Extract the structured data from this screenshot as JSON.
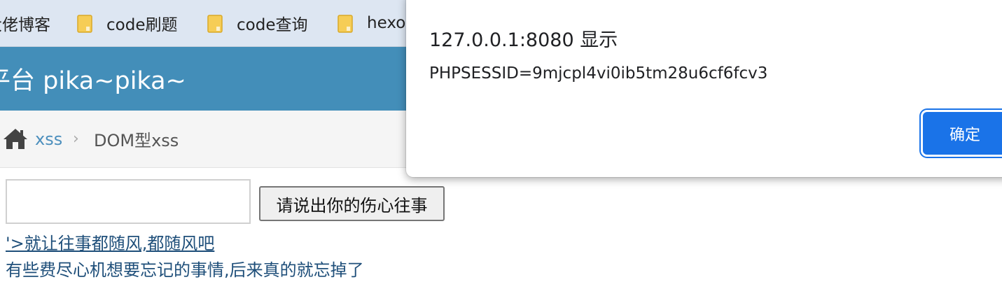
{
  "bookmarks": {
    "items": [
      {
        "label": "大佬博客",
        "icon": "folder-icon"
      },
      {
        "label": "code刷题",
        "icon": "folder-icon"
      },
      {
        "label": "code查询",
        "icon": "folder-icon"
      },
      {
        "label": "hexo",
        "icon": "folder-icon"
      }
    ],
    "folder_color": "#f6cd56"
  },
  "header": {
    "title": "漏洞练习平台 pika~pika~",
    "background": "#438eb9"
  },
  "breadcrumb": {
    "home_icon": "home-icon",
    "link": "xss",
    "separator": "›",
    "current": "DOM型xss"
  },
  "form": {
    "input_value": "",
    "button_label": "请说出你的伤心往事"
  },
  "result": {
    "link_text": "'>就让往事都随风,都随风吧",
    "hint_text": "有些费尽心机想要忘记的事情,后来真的就忘掉了"
  },
  "dialog": {
    "title": "127.0.0.1:8080 显示",
    "message": "PHPSESSID=9mjcpl4vi0ib5tm28u6cf6fcv3",
    "ok_label": "确定",
    "accent": "#1a73e8"
  }
}
